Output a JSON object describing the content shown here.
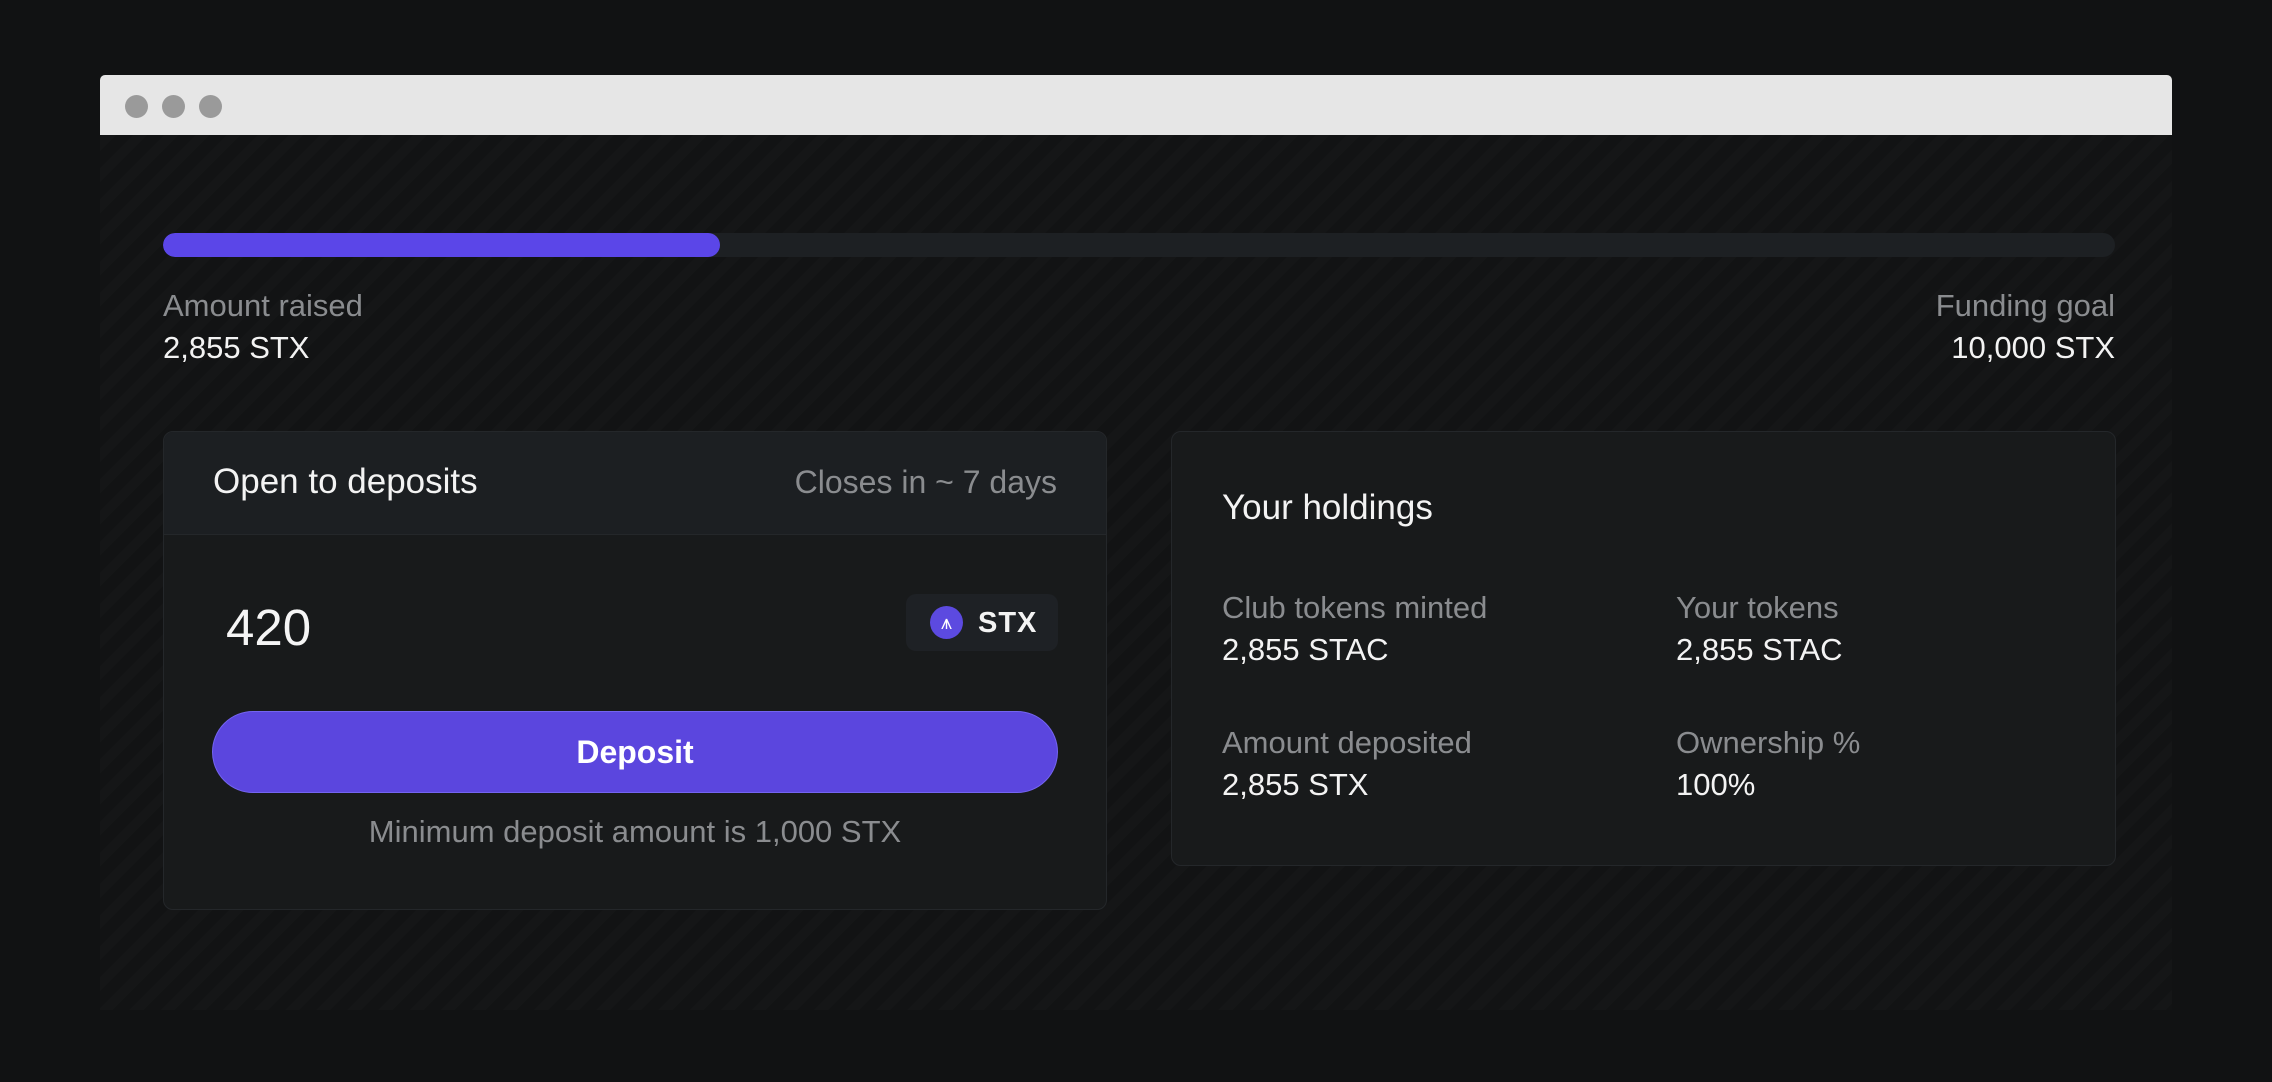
{
  "progress": {
    "fraction": 0.2855,
    "fill_color": "#5b46e8",
    "track_color": "#1d2023"
  },
  "stats": {
    "amount_raised_label": "Amount raised",
    "amount_raised_value": "2,855 STX",
    "funding_goal_label": "Funding goal",
    "funding_goal_value": "10,000 STX"
  },
  "deposit": {
    "title": "Open to deposits",
    "closes": "Closes in ~ 7 days",
    "amount_value": "420",
    "token_icon": "stacks-logo-icon",
    "token_label": "STX",
    "button_label": "Deposit",
    "button_color": "#5b46de",
    "note": "Minimum deposit amount is 1,000 STX"
  },
  "holdings": {
    "title": "Your holdings",
    "items": [
      {
        "label": "Club tokens minted",
        "value": "2,855 STAC"
      },
      {
        "label": "Your tokens",
        "value": "2,855 STAC"
      },
      {
        "label": "Amount deposited",
        "value": "2,855 STX"
      },
      {
        "label": "Ownership %",
        "value": "100%"
      }
    ]
  }
}
